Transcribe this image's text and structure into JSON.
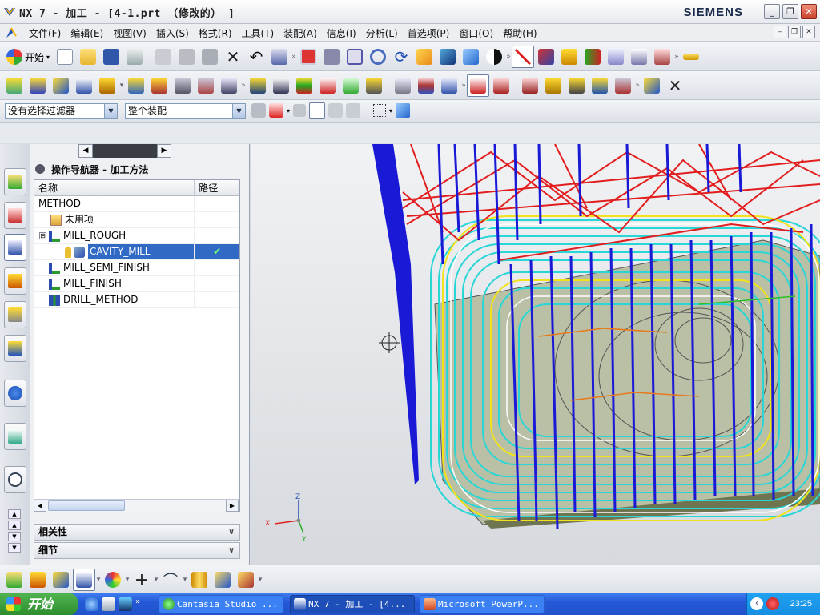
{
  "window": {
    "title": "NX 7 - 加工 - [4-1.prt （修改的） ]",
    "brand": "SIEMENS",
    "min": "_",
    "max": "❐",
    "close": "✕"
  },
  "menu": {
    "items": [
      "文件(F)",
      "编辑(E)",
      "视图(V)",
      "插入(S)",
      "格式(R)",
      "工具(T)",
      "装配(A)",
      "信息(I)",
      "分析(L)",
      "首选项(P)",
      "窗口(O)",
      "帮助(H)"
    ]
  },
  "toolbar": {
    "start_label": "开始",
    "filter_combo": "没有选择过滤器",
    "assembly_combo": "整个装配"
  },
  "navigator": {
    "title": "操作导航器 - 加工方法",
    "col_name": "名称",
    "col_path": "路径",
    "rows": [
      {
        "name": "METHOD",
        "path": ""
      },
      {
        "name": "未用项",
        "path": ""
      },
      {
        "name": "MILL_ROUGH",
        "path": ""
      },
      {
        "name": "CAVITY_MILL",
        "path": "✔"
      },
      {
        "name": "MILL_SEMI_FINISH",
        "path": ""
      },
      {
        "name": "MILL_FINISH",
        "path": ""
      },
      {
        "name": "DRILL_METHOD",
        "path": ""
      }
    ],
    "expander": "⊟",
    "section_related": "相关性",
    "section_detail": "细节"
  },
  "viewport": {
    "axis_z": "Z",
    "axis_x": "X",
    "axis_y": "Y"
  },
  "taskbar": {
    "start": "开始",
    "tasks": [
      "Cantasia Studio ...",
      "NX 7 - 加工 - [4...",
      "Microsoft PowerP..."
    ],
    "clock": "23:25"
  },
  "colors": {
    "accent": "#316ac5",
    "toolpath_red": "#e21d1d",
    "toolpath_blue": "#1a1ad6",
    "toolpath_cyan": "#29d6d6",
    "toolpath_yellow": "#f2e21a"
  }
}
